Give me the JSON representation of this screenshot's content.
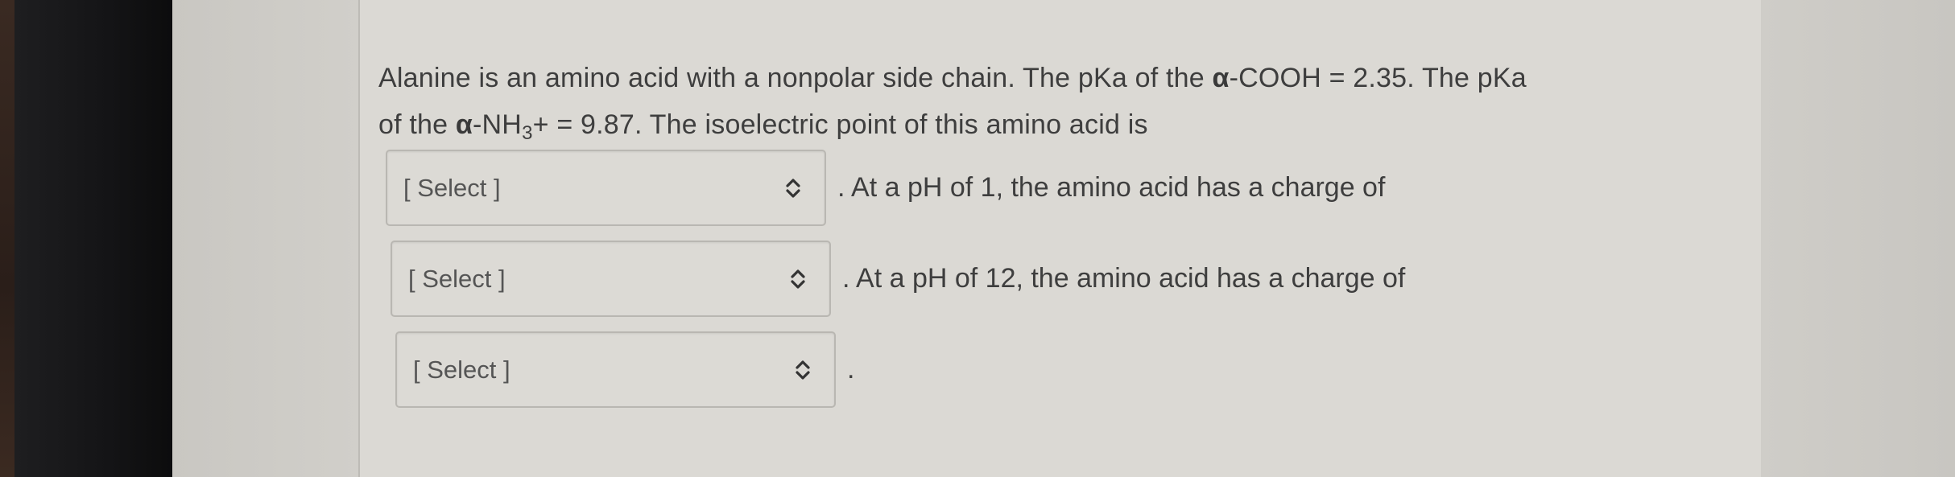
{
  "question": {
    "line1_text": "Alanine is an amino acid with a nonpolar side chain. The pKa of the ",
    "line1_alpha": "α",
    "line1_text2": "-COOH = 2.35. The pKa",
    "line2_text": "of the ",
    "line2_alpha": "α",
    "line2_nh": "-NH",
    "line2_sub": "3",
    "line2_text2": "+ = 9.87. The isoelectric point of this amino acid is"
  },
  "selects": [
    {
      "value": "[ Select ]",
      "after": ". At a pH of 1, the amino acid has a charge of"
    },
    {
      "value": "[ Select ]",
      "after": ". At a pH of 12, the amino acid has a charge of"
    },
    {
      "value": "[ Select ]",
      "after": "."
    }
  ],
  "icons": {
    "select_chevron": "chevron-up-down-icon"
  },
  "colors": {
    "text": "#3e3e3e",
    "panel": "#dbd9d4",
    "bezel": "#141416"
  }
}
